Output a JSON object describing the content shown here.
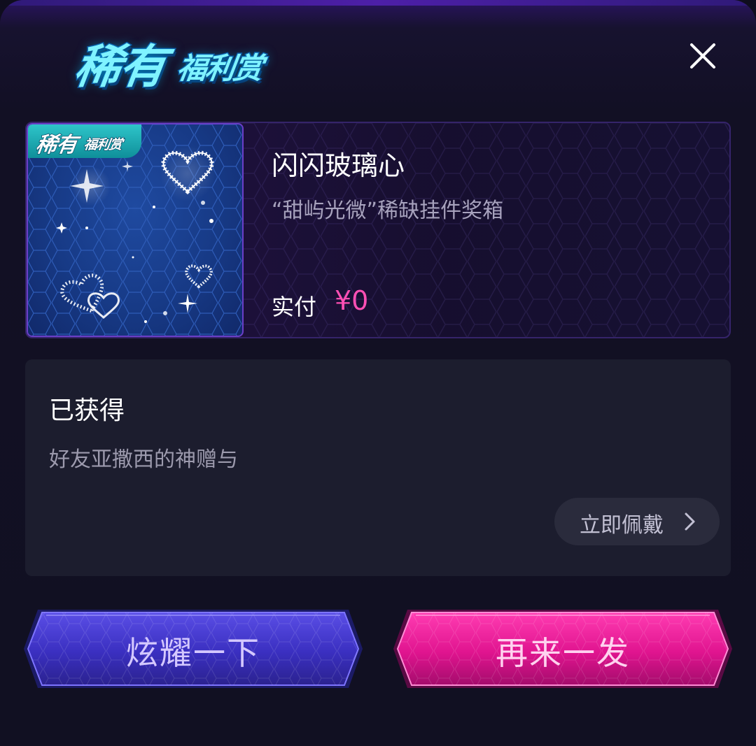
{
  "header": {
    "logo_text_big": "稀有",
    "logo_text_small": "福利赏",
    "close_icon": "close-icon"
  },
  "reward": {
    "badge_big": "稀有",
    "badge_small": "福利赏",
    "name": "闪闪玻璃心",
    "description": "“甜屿光微”稀缺挂件奖箱",
    "price_label": "实付",
    "price_value": "¥0",
    "thumbnail_icon": "sparkle-hearts-icon"
  },
  "obtained": {
    "title": "已获得",
    "source": "好友亚撒西的神赠与",
    "wear_label": "立即佩戴"
  },
  "actions": {
    "show_off_label": "炫耀一下",
    "again_label": "再来一发"
  },
  "colors": {
    "background": "#111022",
    "accent_pink": "#ff4fb4",
    "button_blue": "#3b2fb8",
    "button_pink": "#d8188f"
  }
}
